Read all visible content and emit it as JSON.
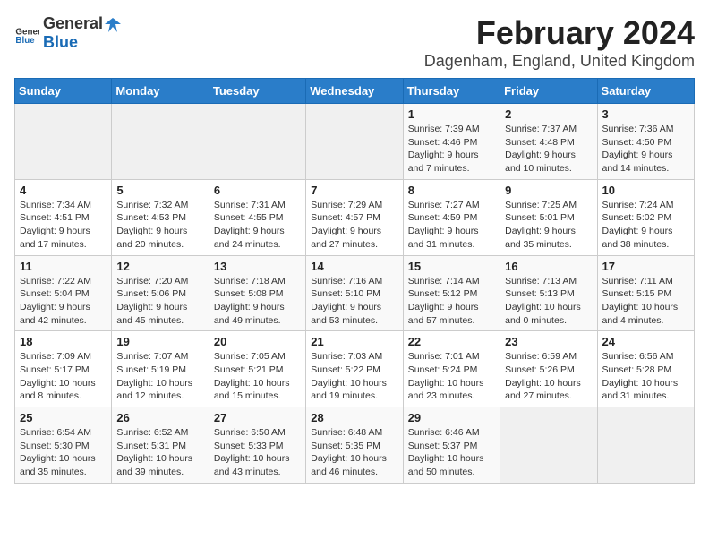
{
  "header": {
    "logo_general": "General",
    "logo_blue": "Blue",
    "title": "February 2024",
    "subtitle": "Dagenham, England, United Kingdom"
  },
  "calendar": {
    "weekdays": [
      "Sunday",
      "Monday",
      "Tuesday",
      "Wednesday",
      "Thursday",
      "Friday",
      "Saturday"
    ],
    "weeks": [
      [
        {
          "day": "",
          "info": ""
        },
        {
          "day": "",
          "info": ""
        },
        {
          "day": "",
          "info": ""
        },
        {
          "day": "",
          "info": ""
        },
        {
          "day": "1",
          "info": "Sunrise: 7:39 AM\nSunset: 4:46 PM\nDaylight: 9 hours\nand 7 minutes."
        },
        {
          "day": "2",
          "info": "Sunrise: 7:37 AM\nSunset: 4:48 PM\nDaylight: 9 hours\nand 10 minutes."
        },
        {
          "day": "3",
          "info": "Sunrise: 7:36 AM\nSunset: 4:50 PM\nDaylight: 9 hours\nand 14 minutes."
        }
      ],
      [
        {
          "day": "4",
          "info": "Sunrise: 7:34 AM\nSunset: 4:51 PM\nDaylight: 9 hours\nand 17 minutes."
        },
        {
          "day": "5",
          "info": "Sunrise: 7:32 AM\nSunset: 4:53 PM\nDaylight: 9 hours\nand 20 minutes."
        },
        {
          "day": "6",
          "info": "Sunrise: 7:31 AM\nSunset: 4:55 PM\nDaylight: 9 hours\nand 24 minutes."
        },
        {
          "day": "7",
          "info": "Sunrise: 7:29 AM\nSunset: 4:57 PM\nDaylight: 9 hours\nand 27 minutes."
        },
        {
          "day": "8",
          "info": "Sunrise: 7:27 AM\nSunset: 4:59 PM\nDaylight: 9 hours\nand 31 minutes."
        },
        {
          "day": "9",
          "info": "Sunrise: 7:25 AM\nSunset: 5:01 PM\nDaylight: 9 hours\nand 35 minutes."
        },
        {
          "day": "10",
          "info": "Sunrise: 7:24 AM\nSunset: 5:02 PM\nDaylight: 9 hours\nand 38 minutes."
        }
      ],
      [
        {
          "day": "11",
          "info": "Sunrise: 7:22 AM\nSunset: 5:04 PM\nDaylight: 9 hours\nand 42 minutes."
        },
        {
          "day": "12",
          "info": "Sunrise: 7:20 AM\nSunset: 5:06 PM\nDaylight: 9 hours\nand 45 minutes."
        },
        {
          "day": "13",
          "info": "Sunrise: 7:18 AM\nSunset: 5:08 PM\nDaylight: 9 hours\nand 49 minutes."
        },
        {
          "day": "14",
          "info": "Sunrise: 7:16 AM\nSunset: 5:10 PM\nDaylight: 9 hours\nand 53 minutes."
        },
        {
          "day": "15",
          "info": "Sunrise: 7:14 AM\nSunset: 5:12 PM\nDaylight: 9 hours\nand 57 minutes."
        },
        {
          "day": "16",
          "info": "Sunrise: 7:13 AM\nSunset: 5:13 PM\nDaylight: 10 hours\nand 0 minutes."
        },
        {
          "day": "17",
          "info": "Sunrise: 7:11 AM\nSunset: 5:15 PM\nDaylight: 10 hours\nand 4 minutes."
        }
      ],
      [
        {
          "day": "18",
          "info": "Sunrise: 7:09 AM\nSunset: 5:17 PM\nDaylight: 10 hours\nand 8 minutes."
        },
        {
          "day": "19",
          "info": "Sunrise: 7:07 AM\nSunset: 5:19 PM\nDaylight: 10 hours\nand 12 minutes."
        },
        {
          "day": "20",
          "info": "Sunrise: 7:05 AM\nSunset: 5:21 PM\nDaylight: 10 hours\nand 15 minutes."
        },
        {
          "day": "21",
          "info": "Sunrise: 7:03 AM\nSunset: 5:22 PM\nDaylight: 10 hours\nand 19 minutes."
        },
        {
          "day": "22",
          "info": "Sunrise: 7:01 AM\nSunset: 5:24 PM\nDaylight: 10 hours\nand 23 minutes."
        },
        {
          "day": "23",
          "info": "Sunrise: 6:59 AM\nSunset: 5:26 PM\nDaylight: 10 hours\nand 27 minutes."
        },
        {
          "day": "24",
          "info": "Sunrise: 6:56 AM\nSunset: 5:28 PM\nDaylight: 10 hours\nand 31 minutes."
        }
      ],
      [
        {
          "day": "25",
          "info": "Sunrise: 6:54 AM\nSunset: 5:30 PM\nDaylight: 10 hours\nand 35 minutes."
        },
        {
          "day": "26",
          "info": "Sunrise: 6:52 AM\nSunset: 5:31 PM\nDaylight: 10 hours\nand 39 minutes."
        },
        {
          "day": "27",
          "info": "Sunrise: 6:50 AM\nSunset: 5:33 PM\nDaylight: 10 hours\nand 43 minutes."
        },
        {
          "day": "28",
          "info": "Sunrise: 6:48 AM\nSunset: 5:35 PM\nDaylight: 10 hours\nand 46 minutes."
        },
        {
          "day": "29",
          "info": "Sunrise: 6:46 AM\nSunset: 5:37 PM\nDaylight: 10 hours\nand 50 minutes."
        },
        {
          "day": "",
          "info": ""
        },
        {
          "day": "",
          "info": ""
        }
      ]
    ]
  }
}
